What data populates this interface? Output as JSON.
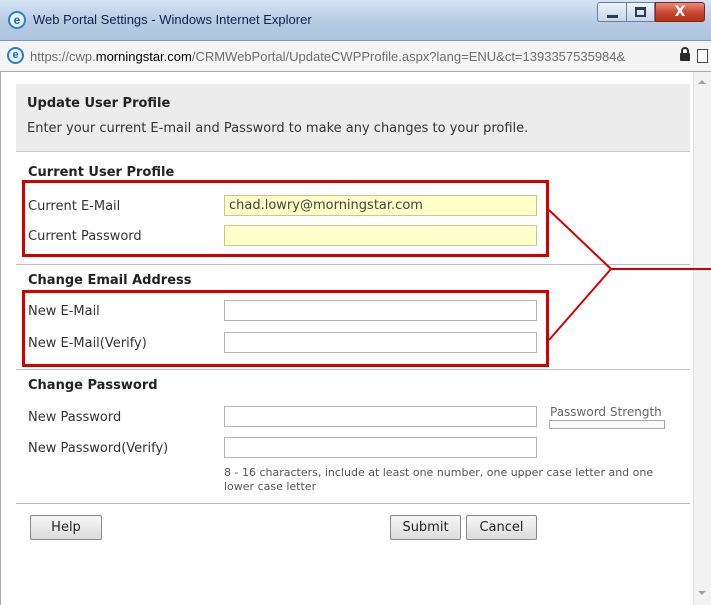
{
  "window": {
    "title": "Web Portal Settings - Windows Internet Explorer",
    "close_glyph": "X",
    "ie_glyph": "e"
  },
  "address": {
    "url_prefix": "https://cwp.",
    "url_host": "morningstar.com",
    "url_rest": "/CRMWebPortal/UpdateCWPProfile.aspx?lang=ENU&ct=1393357535984&"
  },
  "header": {
    "title": "Update User Profile",
    "description": "Enter your current E-mail and Password to make any changes to your profile."
  },
  "current_profile": {
    "title": "Current User Profile",
    "email_label": "Current E-Mail",
    "email_value": "chad.lowry@morningstar.com",
    "password_label": "Current Password",
    "password_value": ""
  },
  "change_email": {
    "title": "Change Email Address",
    "new_email_label": "New E-Mail",
    "new_email_value": "",
    "verify_email_label": "New E-Mail(Verify)",
    "verify_email_value": ""
  },
  "change_password": {
    "title": "Change Password",
    "new_password_label": "New Password",
    "verify_password_label": "New Password(Verify)",
    "strength_label": "Password Strength",
    "hint": "8 - 16 characters, include at least one number, one upper case letter and one lower case letter"
  },
  "buttons": {
    "help": "Help",
    "submit": "Submit",
    "cancel": "Cancel"
  },
  "colors": {
    "highlight": "#d40000",
    "prefilled_field": "#ffffc8"
  }
}
